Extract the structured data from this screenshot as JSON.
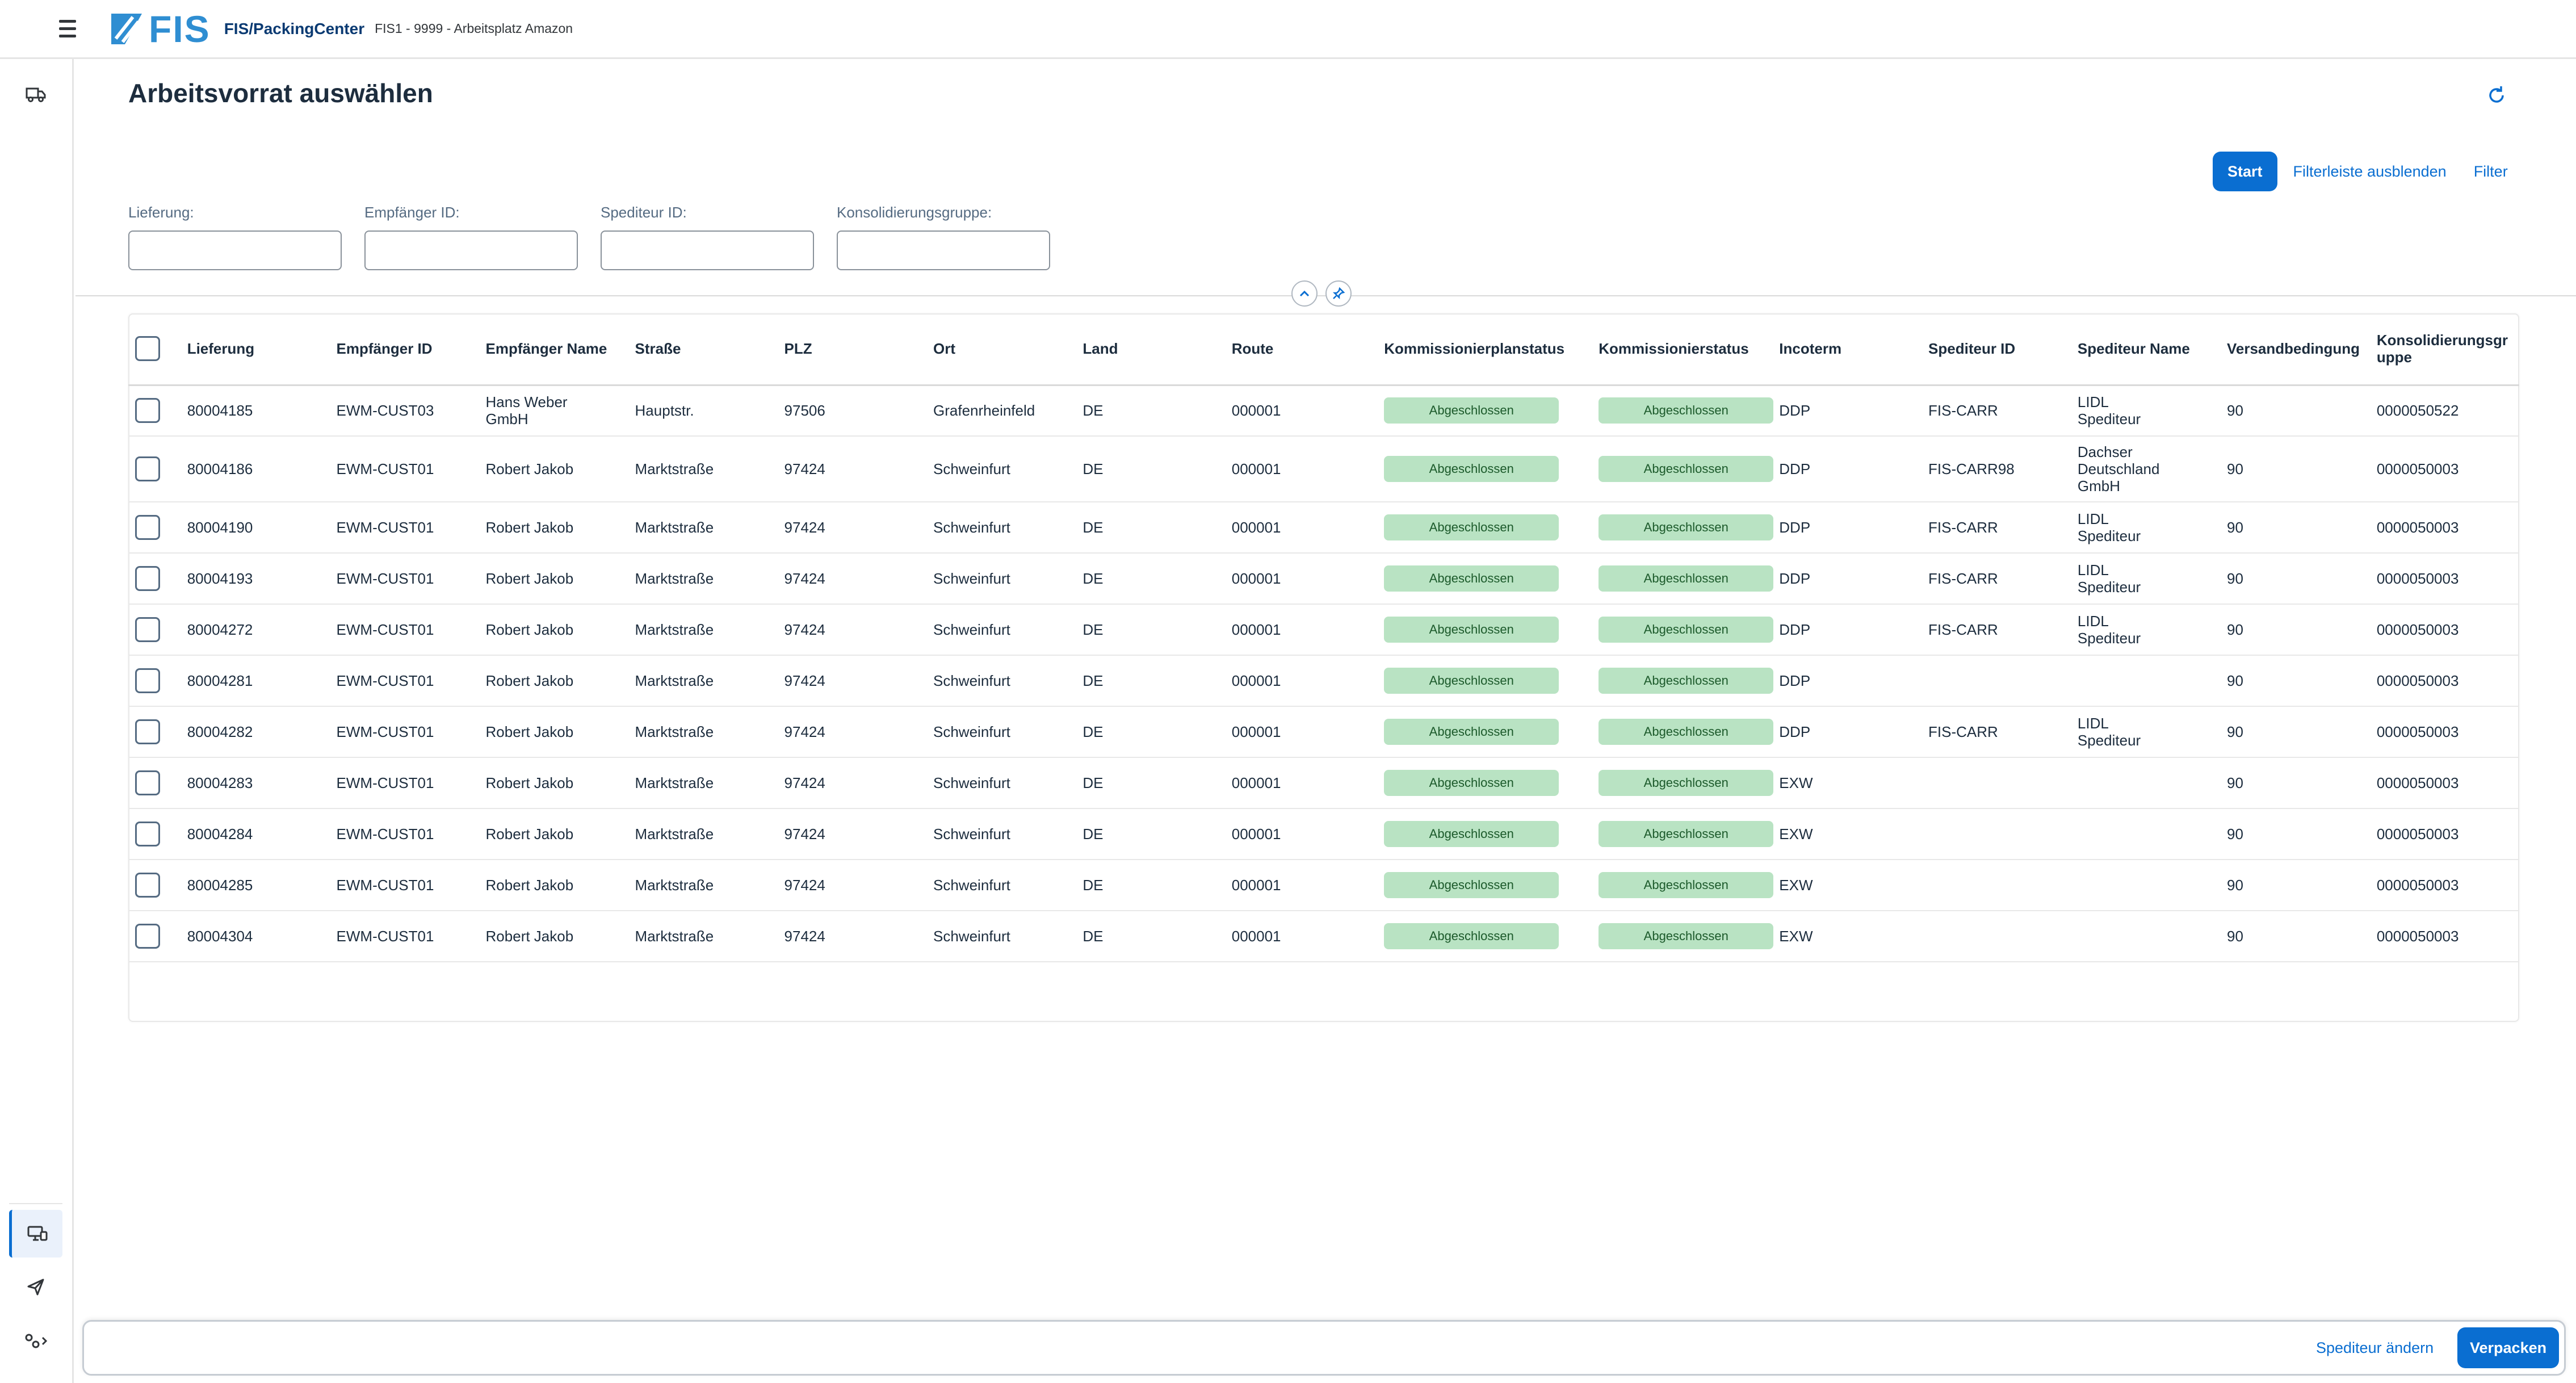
{
  "shell": {
    "logo_text": "FIS",
    "app_title": "FIS/PackingCenter",
    "app_subtitle": "FIS1 - 9999 - Arbeitsplatz Amazon"
  },
  "page": {
    "title": "Arbeitsvorrat auswählen"
  },
  "filterbar": {
    "start_label": "Start",
    "hide_label": "Filterleiste ausblenden",
    "filter_label": "Filter",
    "fields": [
      {
        "label": "Lieferung:",
        "value": ""
      },
      {
        "label": "Empfänger ID:",
        "value": ""
      },
      {
        "label": "Spediteur ID:",
        "value": ""
      },
      {
        "label": "Konsolidierungsgruppe:",
        "value": ""
      }
    ]
  },
  "table": {
    "columns": [
      "Lieferung",
      "Empfänger ID",
      "Empfänger Name",
      "Straße",
      "PLZ",
      "Ort",
      "Land",
      "Route",
      "Kommissionierplanstatus",
      "Kommissionierstatus",
      "Incoterm",
      "Spediteur ID",
      "Spediteur Name",
      "Versandbedingung",
      "Konsolidierungsgruppe"
    ],
    "status_color": "#b9e3c3",
    "rows": [
      {
        "lieferung": "80004185",
        "empf_id": "EWM-CUST03",
        "empf_name": "Hans Weber GmbH",
        "strasse": "Hauptstr.",
        "plz": "97506",
        "ort": "Grafenrheinfeld",
        "land": "DE",
        "route": "000001",
        "kplan": "Abgeschlossen",
        "kstatus": "Abgeschlossen",
        "incoterm": "DDP",
        "sped_id": "FIS-CARR",
        "sped_name": "LIDL Spediteur",
        "versand": "90",
        "konsol": "0000050522"
      },
      {
        "lieferung": "80004186",
        "empf_id": "EWM-CUST01",
        "empf_name": "Robert Jakob",
        "strasse": "Marktstraße",
        "plz": "97424",
        "ort": "Schweinfurt",
        "land": "DE",
        "route": "000001",
        "kplan": "Abgeschlossen",
        "kstatus": "Abgeschlossen",
        "incoterm": "DDP",
        "sped_id": "FIS-CARR98",
        "sped_name": "Dachser Deutschland GmbH",
        "versand": "90",
        "konsol": "0000050003"
      },
      {
        "lieferung": "80004190",
        "empf_id": "EWM-CUST01",
        "empf_name": "Robert Jakob",
        "strasse": "Marktstraße",
        "plz": "97424",
        "ort": "Schweinfurt",
        "land": "DE",
        "route": "000001",
        "kplan": "Abgeschlossen",
        "kstatus": "Abgeschlossen",
        "incoterm": "DDP",
        "sped_id": "FIS-CARR",
        "sped_name": "LIDL Spediteur",
        "versand": "90",
        "konsol": "0000050003"
      },
      {
        "lieferung": "80004193",
        "empf_id": "EWM-CUST01",
        "empf_name": "Robert Jakob",
        "strasse": "Marktstraße",
        "plz": "97424",
        "ort": "Schweinfurt",
        "land": "DE",
        "route": "000001",
        "kplan": "Abgeschlossen",
        "kstatus": "Abgeschlossen",
        "incoterm": "DDP",
        "sped_id": "FIS-CARR",
        "sped_name": "LIDL Spediteur",
        "versand": "90",
        "konsol": "0000050003"
      },
      {
        "lieferung": "80004272",
        "empf_id": "EWM-CUST01",
        "empf_name": "Robert Jakob",
        "strasse": "Marktstraße",
        "plz": "97424",
        "ort": "Schweinfurt",
        "land": "DE",
        "route": "000001",
        "kplan": "Abgeschlossen",
        "kstatus": "Abgeschlossen",
        "incoterm": "DDP",
        "sped_id": "FIS-CARR",
        "sped_name": "LIDL Spediteur",
        "versand": "90",
        "konsol": "0000050003"
      },
      {
        "lieferung": "80004281",
        "empf_id": "EWM-CUST01",
        "empf_name": "Robert Jakob",
        "strasse": "Marktstraße",
        "plz": "97424",
        "ort": "Schweinfurt",
        "land": "DE",
        "route": "000001",
        "kplan": "Abgeschlossen",
        "kstatus": "Abgeschlossen",
        "incoterm": "DDP",
        "sped_id": "",
        "sped_name": "",
        "versand": "90",
        "konsol": "0000050003"
      },
      {
        "lieferung": "80004282",
        "empf_id": "EWM-CUST01",
        "empf_name": "Robert Jakob",
        "strasse": "Marktstraße",
        "plz": "97424",
        "ort": "Schweinfurt",
        "land": "DE",
        "route": "000001",
        "kplan": "Abgeschlossen",
        "kstatus": "Abgeschlossen",
        "incoterm": "DDP",
        "sped_id": "FIS-CARR",
        "sped_name": "LIDL Spediteur",
        "versand": "90",
        "konsol": "0000050003"
      },
      {
        "lieferung": "80004283",
        "empf_id": "EWM-CUST01",
        "empf_name": "Robert Jakob",
        "strasse": "Marktstraße",
        "plz": "97424",
        "ort": "Schweinfurt",
        "land": "DE",
        "route": "000001",
        "kplan": "Abgeschlossen",
        "kstatus": "Abgeschlossen",
        "incoterm": "EXW",
        "sped_id": "",
        "sped_name": "",
        "versand": "90",
        "konsol": "0000050003"
      },
      {
        "lieferung": "80004284",
        "empf_id": "EWM-CUST01",
        "empf_name": "Robert Jakob",
        "strasse": "Marktstraße",
        "plz": "97424",
        "ort": "Schweinfurt",
        "land": "DE",
        "route": "000001",
        "kplan": "Abgeschlossen",
        "kstatus": "Abgeschlossen",
        "incoterm": "EXW",
        "sped_id": "",
        "sped_name": "",
        "versand": "90",
        "konsol": "0000050003"
      },
      {
        "lieferung": "80004285",
        "empf_id": "EWM-CUST01",
        "empf_name": "Robert Jakob",
        "strasse": "Marktstraße",
        "plz": "97424",
        "ort": "Schweinfurt",
        "land": "DE",
        "route": "000001",
        "kplan": "Abgeschlossen",
        "kstatus": "Abgeschlossen",
        "incoterm": "EXW",
        "sped_id": "",
        "sped_name": "",
        "versand": "90",
        "konsol": "0000050003"
      },
      {
        "lieferung": "80004304",
        "empf_id": "EWM-CUST01",
        "empf_name": "Robert Jakob",
        "strasse": "Marktstraße",
        "plz": "97424",
        "ort": "Schweinfurt",
        "land": "DE",
        "route": "000001",
        "kplan": "Abgeschlossen",
        "kstatus": "Abgeschlossen",
        "incoterm": "EXW",
        "sped_id": "",
        "sped_name": "",
        "versand": "90",
        "konsol": "0000050003"
      }
    ]
  },
  "footer": {
    "change_carrier_label": "Spediteur ändern",
    "pack_label": "Verpacken"
  },
  "sidenav": {
    "icons": [
      "truck-icon",
      "workstation-icon",
      "send-icon",
      "settings-icon"
    ]
  }
}
